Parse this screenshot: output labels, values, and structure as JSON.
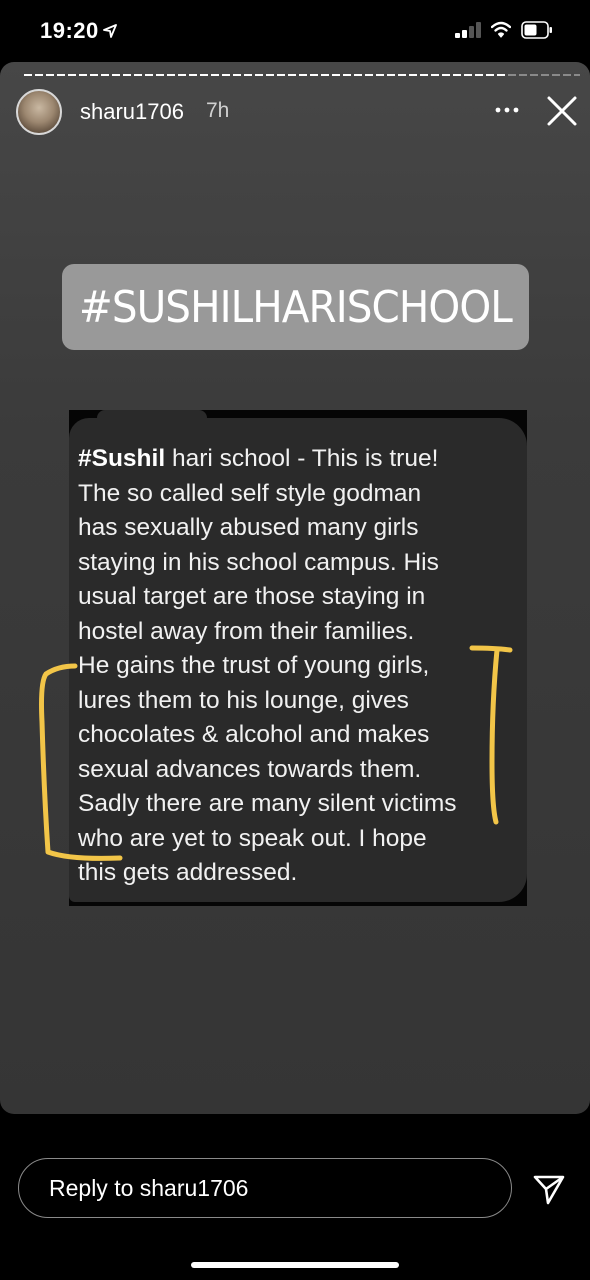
{
  "status_bar": {
    "time": "19:20",
    "location_arrow_icon": "location-arrow-icon",
    "signal_icon": "cellular-signal-icon",
    "wifi_icon": "wifi-icon",
    "battery_icon": "battery-icon"
  },
  "story": {
    "progress": 0.86,
    "user": {
      "username": "sharu1706",
      "time_ago": "7h",
      "avatar_icon": "avatar"
    },
    "actions": {
      "more_icon": "more-horizontal-icon",
      "close_icon": "close-icon"
    },
    "hashtag_sticker": "#SUSHILHARISCHOOL",
    "message": {
      "bold_prefix": "#Sushil",
      "lines": [
        " hari school - This is true!",
        "The so called self style godman",
        "has sexually abused many girls",
        "staying in his school campus. His",
        "usual target are those staying in",
        "hostel away from their families.",
        "He gains the trust of young girls,",
        "lures them to his lounge,  gives",
        "chocolates & alcohol and makes",
        "sexual advances towards them.",
        "Sadly there are many silent victims",
        "who are yet to speak out.  I hope",
        "this gets addressed."
      ]
    },
    "annotation_color": "#F2C548"
  },
  "reply": {
    "placeholder": "Reply to sharu1706",
    "send_icon": "send-icon"
  }
}
